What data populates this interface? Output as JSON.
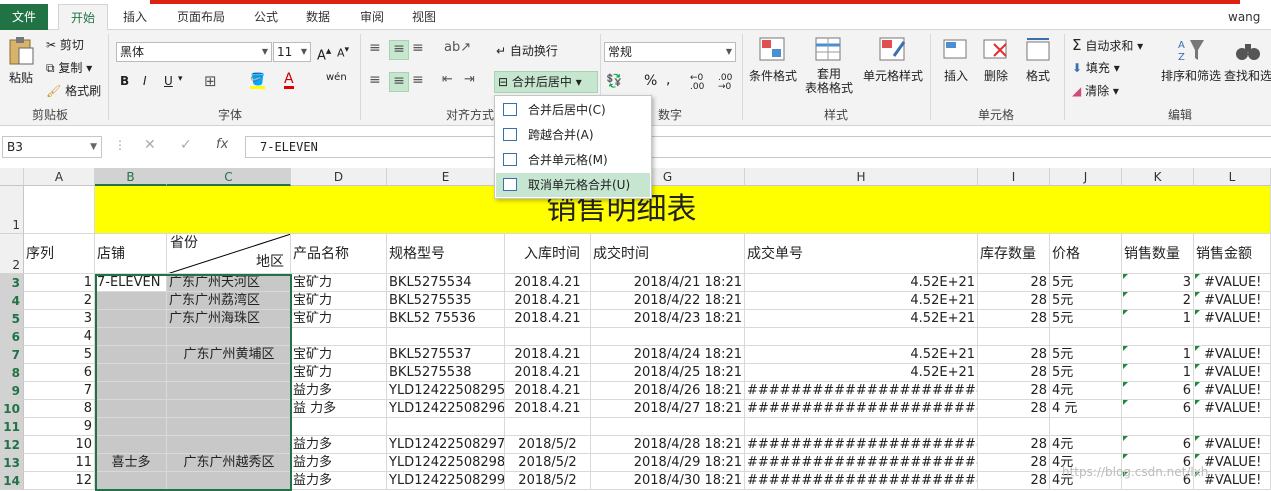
{
  "tabs": [
    "文件",
    "开始",
    "插入",
    "页面布局",
    "公式",
    "数据",
    "审阅",
    "视图"
  ],
  "user": "wang",
  "ribbon": {
    "clipboard": {
      "paste": "粘贴",
      "cut": "剪切",
      "copy": "复制",
      "format_painter": "格式刷",
      "label": "剪贴板"
    },
    "font": {
      "name": "黑体",
      "size": "11",
      "label": "字体",
      "bold": "B",
      "italic": "I",
      "underline": "U",
      "wen": "wén"
    },
    "align": {
      "wrap": "自动换行",
      "merge": "合并后居中",
      "label": "对齐方式"
    },
    "number": {
      "format": "常规",
      "label": "数字",
      "percent": "%",
      "comma": ","
    },
    "styles": {
      "cond": "条件格式",
      "table": "套用",
      "table2": "表格格式",
      "cell": "单元格样式",
      "label": "样式"
    },
    "cells": {
      "insert": "插入",
      "delete": "删除",
      "format": "格式",
      "label": "单元格"
    },
    "edit": {
      "autosum": "自动求和",
      "fill": "填充",
      "clear": "清除",
      "sort": "排序和筛选",
      "find": "查找和选",
      "label": "编辑"
    }
  },
  "merge_menu": [
    "合并后居中(C)",
    "跨越合并(A)",
    "合并单元格(M)",
    "取消单元格合并(U)"
  ],
  "namebox": "B3",
  "formula": "7-ELEVEN",
  "columns": [
    "A",
    "B",
    "C",
    "D",
    "E",
    "F",
    "G",
    "H",
    "I",
    "J",
    "K",
    "L"
  ],
  "title": "销售明细表",
  "headers": {
    "seq": "序列",
    "store": "店铺",
    "province": "省份",
    "district": "地区",
    "product": "产品名称",
    "model": "规格型号",
    "in_time": "入库时间",
    "deal_time": "成交时间",
    "order": "成交单号",
    "stock": "库存数量",
    "price": "价格",
    "qty": "销售数量",
    "amount": "销售金额"
  },
  "row_numbers": [
    "1",
    "2",
    "3",
    "4",
    "5",
    "6",
    "7",
    "8",
    "9",
    "10",
    "11",
    "12",
    "13",
    "14"
  ],
  "rows": [
    {
      "a": "1",
      "b": "7-ELEVEN",
      "c": "广东广州天河区",
      "d": "宝矿力",
      "e": "BKL5275534",
      "f": "2018.4.21",
      "g": "2018/4/21 18:21",
      "h": "4.52E+21",
      "i": "28",
      "j": "5元",
      "k": "3",
      "l": "#VALUE!"
    },
    {
      "a": "2",
      "b": "",
      "c": "广东广州荔湾区",
      "d": "宝矿力",
      "e": "BKL5275535",
      "f": "2018.4.21",
      "g": "2018/4/22 18:21",
      "h": "4.52E+21",
      "i": "28",
      "j": "5元",
      "k": "2",
      "l": "#VALUE!"
    },
    {
      "a": "3",
      "b": "",
      "c": "广东广州海珠区",
      "d": "宝矿力",
      "e": "BKL52 75536",
      "f": "2018.4.21",
      "g": "2018/4/23 18:21",
      "h": "4.52E+21",
      "i": "28",
      "j": "5元",
      "k": "1",
      "l": "#VALUE!"
    },
    {
      "a": "4",
      "b": "",
      "c": "",
      "d": "",
      "e": "",
      "f": "",
      "g": "",
      "h": "",
      "i": "",
      "j": "",
      "k": "",
      "l": ""
    },
    {
      "a": "5",
      "b": "",
      "c": "",
      "d": "宝矿力",
      "e": "BKL5275537",
      "f": "2018.4.21",
      "g": "2018/4/24 18:21",
      "h": "4.52E+21",
      "i": "28",
      "j": "5元",
      "k": "1",
      "l": "#VALUE!"
    },
    {
      "a": "6",
      "b": "",
      "c": "",
      "d": "宝矿力",
      "e": "BKL5275538",
      "f": "2018.4.21",
      "g": "2018/4/25 18:21",
      "h": "4.52E+21",
      "i": "28",
      "j": "5元",
      "k": "1",
      "l": "#VALUE!"
    },
    {
      "a": "7",
      "b": "",
      "c": "",
      "d": " 益力多",
      "e": "YLD12422508295",
      "f": "2018.4.21",
      "g": "2018/4/26 18:21",
      "h": "##############################",
      "i": "28",
      "j": "4元",
      "k": "6",
      "l": "#VALUE!"
    },
    {
      "a": "8",
      "b": "",
      "c": "",
      "d": "益 力多",
      "e": "YLD12422508296",
      "f": "2018.4.21",
      "g": "2018/4/27 18:21",
      "h": "##############################",
      "i": "28",
      "j": "4 元",
      "k": "6",
      "l": "#VALUE!"
    },
    {
      "a": "9",
      "b": "",
      "c": "",
      "d": "",
      "e": "",
      "f": "",
      "g": "",
      "h": "",
      "i": "",
      "j": "",
      "k": "",
      "l": ""
    },
    {
      "a": "10",
      "b": "",
      "c": "",
      "d": "益力多",
      "e": "YLD12422508297",
      "f": "2018/5/2",
      "g": "2018/4/28 18:21",
      "h": "##############################",
      "i": "28",
      "j": "4元",
      "k": "6",
      "l": "#VALUE!"
    },
    {
      "a": "11",
      "b": "",
      "c": "",
      "d": "益力多",
      "e": "YLD12422508298",
      "f": "2018/5/2",
      "g": "2018/4/29 18:21",
      "h": "##############################",
      "i": "28",
      "j": "4元",
      "k": "6",
      "l": "#VALUE!"
    },
    {
      "a": "12",
      "b": "",
      "c": "",
      "d": "益力多",
      "e": "YLD12422508299",
      "f": "2018/5/2",
      "g": "2018/4/30 18:21",
      "h": "##############################",
      "i": "28",
      "j": "4元",
      "k": "6",
      "l": "#VALUE!"
    }
  ],
  "merged": {
    "c_huangpu": "广东广州黄埔区",
    "b_xishiduo": "喜士多",
    "c_yuexiu": "广东广州越秀区"
  },
  "watermark": "https://blog.csdn.net/lxh_..."
}
